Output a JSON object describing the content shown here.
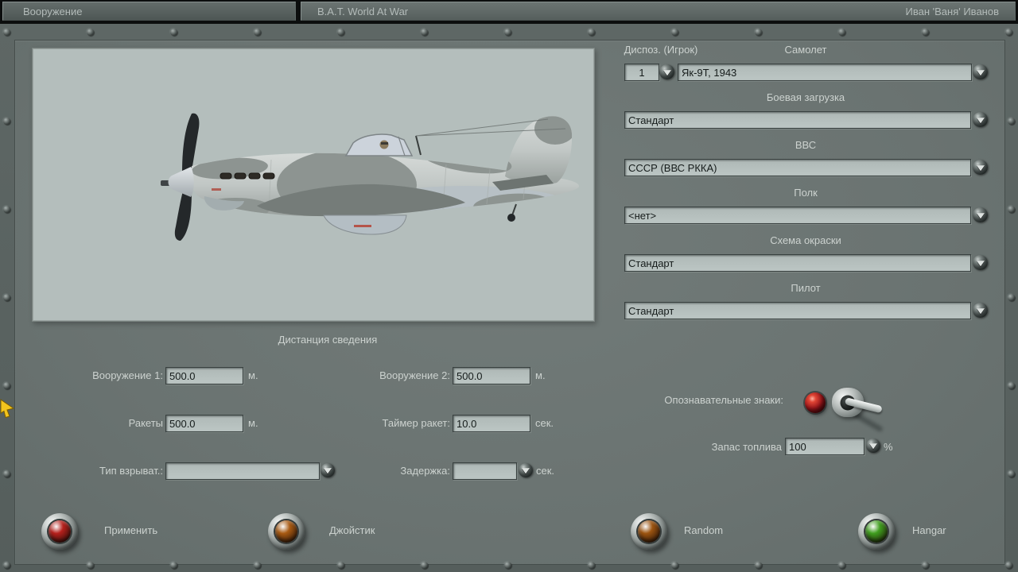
{
  "titlebar": {
    "menu_tab": "Вооружение",
    "app_title": "B.A.T. World At War",
    "player_name": "Иван 'Ваня' Иванов"
  },
  "selectors": {
    "slot_label": "Диспоз. (Игрок)",
    "slot_value": "1",
    "aircraft_label": "Самолет",
    "aircraft_value": "Як-9Т, 1943",
    "loadout_label": "Боевая загрузка",
    "loadout_value": "Стандарт",
    "airforce_label": "ВВС",
    "airforce_value": "СССР (ВВС РККА)",
    "regiment_label": "Полк",
    "regiment_value": "<нет>",
    "paint_label": "Схема окраски",
    "paint_value": "Стандарт",
    "pilot_label": "Пилот",
    "pilot_value": "Стандарт"
  },
  "convergence": {
    "title": "Дистанция сведения",
    "weapon1_label": "Вооружение 1:",
    "weapon1_value": "500.0",
    "weapon1_unit": "м.",
    "weapon2_label": "Вооружение 2:",
    "weapon2_value": "500.0",
    "weapon2_unit": "м.",
    "rockets_label": "Ракеты",
    "rockets_value": "500.0",
    "rockets_unit": "м.",
    "rocket_timer_label": "Таймер ракет:",
    "rocket_timer_value": "10.0",
    "rocket_timer_unit": "сек.",
    "fuse_label": "Тип взрыват.:",
    "fuse_value": "",
    "delay_label": "Задержка:",
    "delay_value": "",
    "delay_unit": "сек."
  },
  "options": {
    "markings_label": "Опознавательные знаки:",
    "fuel_label": "Запас топлива",
    "fuel_value": "100",
    "fuel_unit": "%"
  },
  "actions": [
    {
      "label": "Применить",
      "lamp_color": "#b5201c"
    },
    {
      "label": "Джойстик",
      "lamp_color": "#a85a12"
    },
    {
      "label": "Random",
      "lamp_color": "#9c5410"
    },
    {
      "label": "Hangar",
      "lamp_color": "#3f9e1e"
    }
  ],
  "icons": {
    "dropdown_arrow": "chevron-down",
    "screw": "screw-head",
    "toggle": "toggle-switch-lever",
    "indicator": "round-lamp"
  },
  "colors": {
    "panel": "#6e7775",
    "frame": "#5a6361",
    "field_bg": "#b6c0be",
    "label_text": "#ccd2cf",
    "preview_bg": "#b4bebc"
  }
}
